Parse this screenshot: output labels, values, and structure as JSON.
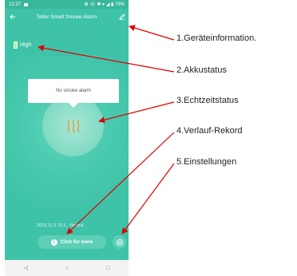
{
  "phone": {
    "status_time": "12:37",
    "status_icons": "⊞ ☏ ✱ ▾ ◢ ▮ 78%",
    "app_title": "Tellur Smart Smoke Alarm",
    "battery_level": "High",
    "popup_text": "No smoke alarm",
    "timestamp": "2023.11.3 12:3_ Normal",
    "click_button": "Click for more",
    "info_glyph": "i",
    "nav_back": "◁",
    "nav_home": "○",
    "nav_recent": "□"
  },
  "annotations": [
    {
      "label": "1.Geräteinformation."
    },
    {
      "label": "2.Akkustatus"
    },
    {
      "label": "3.Echtzeitstatus"
    },
    {
      "label": "4.Verlauf-Rekord"
    },
    {
      "label": "5.Einstellungen"
    }
  ],
  "colors": {
    "app_bg": "#3fc3a8",
    "arrow": "#e00000"
  }
}
